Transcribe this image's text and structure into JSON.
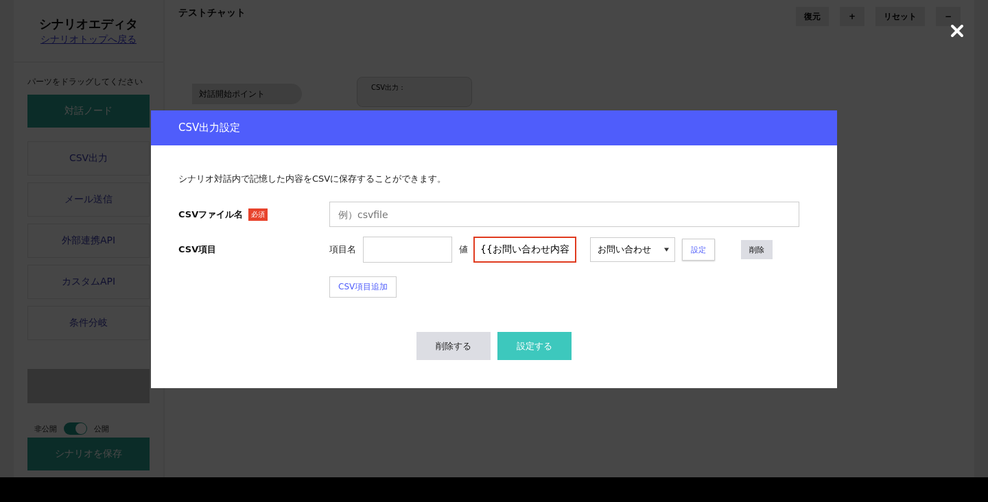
{
  "sidebar": {
    "title": "シナリオエディタ",
    "back_link": "シナリオトップへ戻る",
    "hint": "パーツをドラッグしてください",
    "parts": [
      {
        "label": "対話ノード",
        "kind": "primary"
      },
      {
        "label": "CSV出力",
        "kind": "outline"
      },
      {
        "label": "メール送信",
        "kind": "outline"
      },
      {
        "label": "外部連携API",
        "kind": "outline"
      },
      {
        "label": "カスタムAPI",
        "kind": "outline"
      },
      {
        "label": "条件分岐",
        "kind": "outline"
      }
    ],
    "visibility": {
      "off_label": "非公開",
      "on_label": "公開",
      "on": true
    },
    "save_button": "シナリオを保存"
  },
  "canvas": {
    "title": "テストチャット",
    "toolbar": [
      "復元",
      "+",
      "リセット",
      "−"
    ],
    "nodes": [
      {
        "kind": "start",
        "label": "対話開始ポイント"
      },
      {
        "kind": "csv",
        "label": "CSV出力："
      }
    ]
  },
  "modal": {
    "title": "CSV出力設定",
    "description": "シナリオ対話内で記憶した内容をCSVに保存することができます。",
    "file_name": {
      "label": "CSVファイル名",
      "required_badge": "必須",
      "placeholder": "例）csvfile"
    },
    "items_label": "CSV項目",
    "items": [
      {
        "name_label": "項目名",
        "value_label": "値",
        "value": "{{お問い合わせ内容",
        "error": true,
        "select": "お問い合わせ",
        "set_button": "設定",
        "delete_button": "削除"
      }
    ],
    "add_button": "CSV項目追加",
    "buttons": [
      {
        "label": "削除する",
        "kind": "secondary"
      },
      {
        "label": "設定する",
        "kind": "primary"
      }
    ]
  }
}
